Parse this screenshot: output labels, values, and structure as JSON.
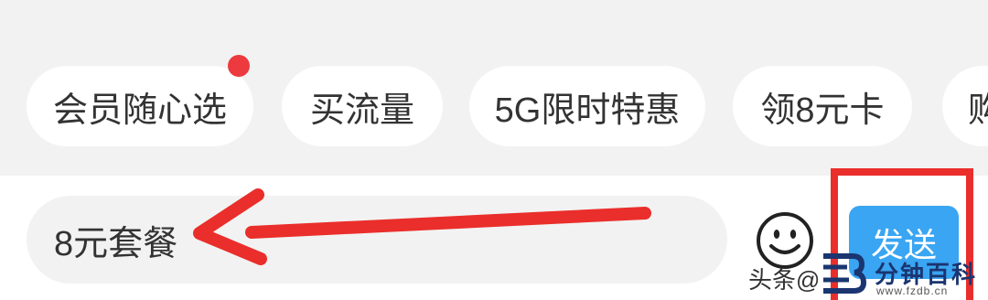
{
  "quick_chips": [
    {
      "label": "会员随心选",
      "has_badge": true
    },
    {
      "label": "买流量"
    },
    {
      "label": "5G限时特惠"
    },
    {
      "label": "领8元卡"
    },
    {
      "label": "购"
    }
  ],
  "message_input": {
    "value": "8元套餐"
  },
  "emoji_button": {
    "icon": "smiley-icon"
  },
  "send_button": {
    "label": "发送"
  },
  "annotations": {
    "arrow_color": "#ea2e2b",
    "highlight_color": "#ea2e2b"
  },
  "watermark": {
    "prefix": "头条@",
    "brand": "分钟百科",
    "url": "www.fzdb.cn"
  },
  "colors": {
    "send_button": "#3aa5f2",
    "badge": "#ec3a3e",
    "background": "#f2f2f2"
  }
}
